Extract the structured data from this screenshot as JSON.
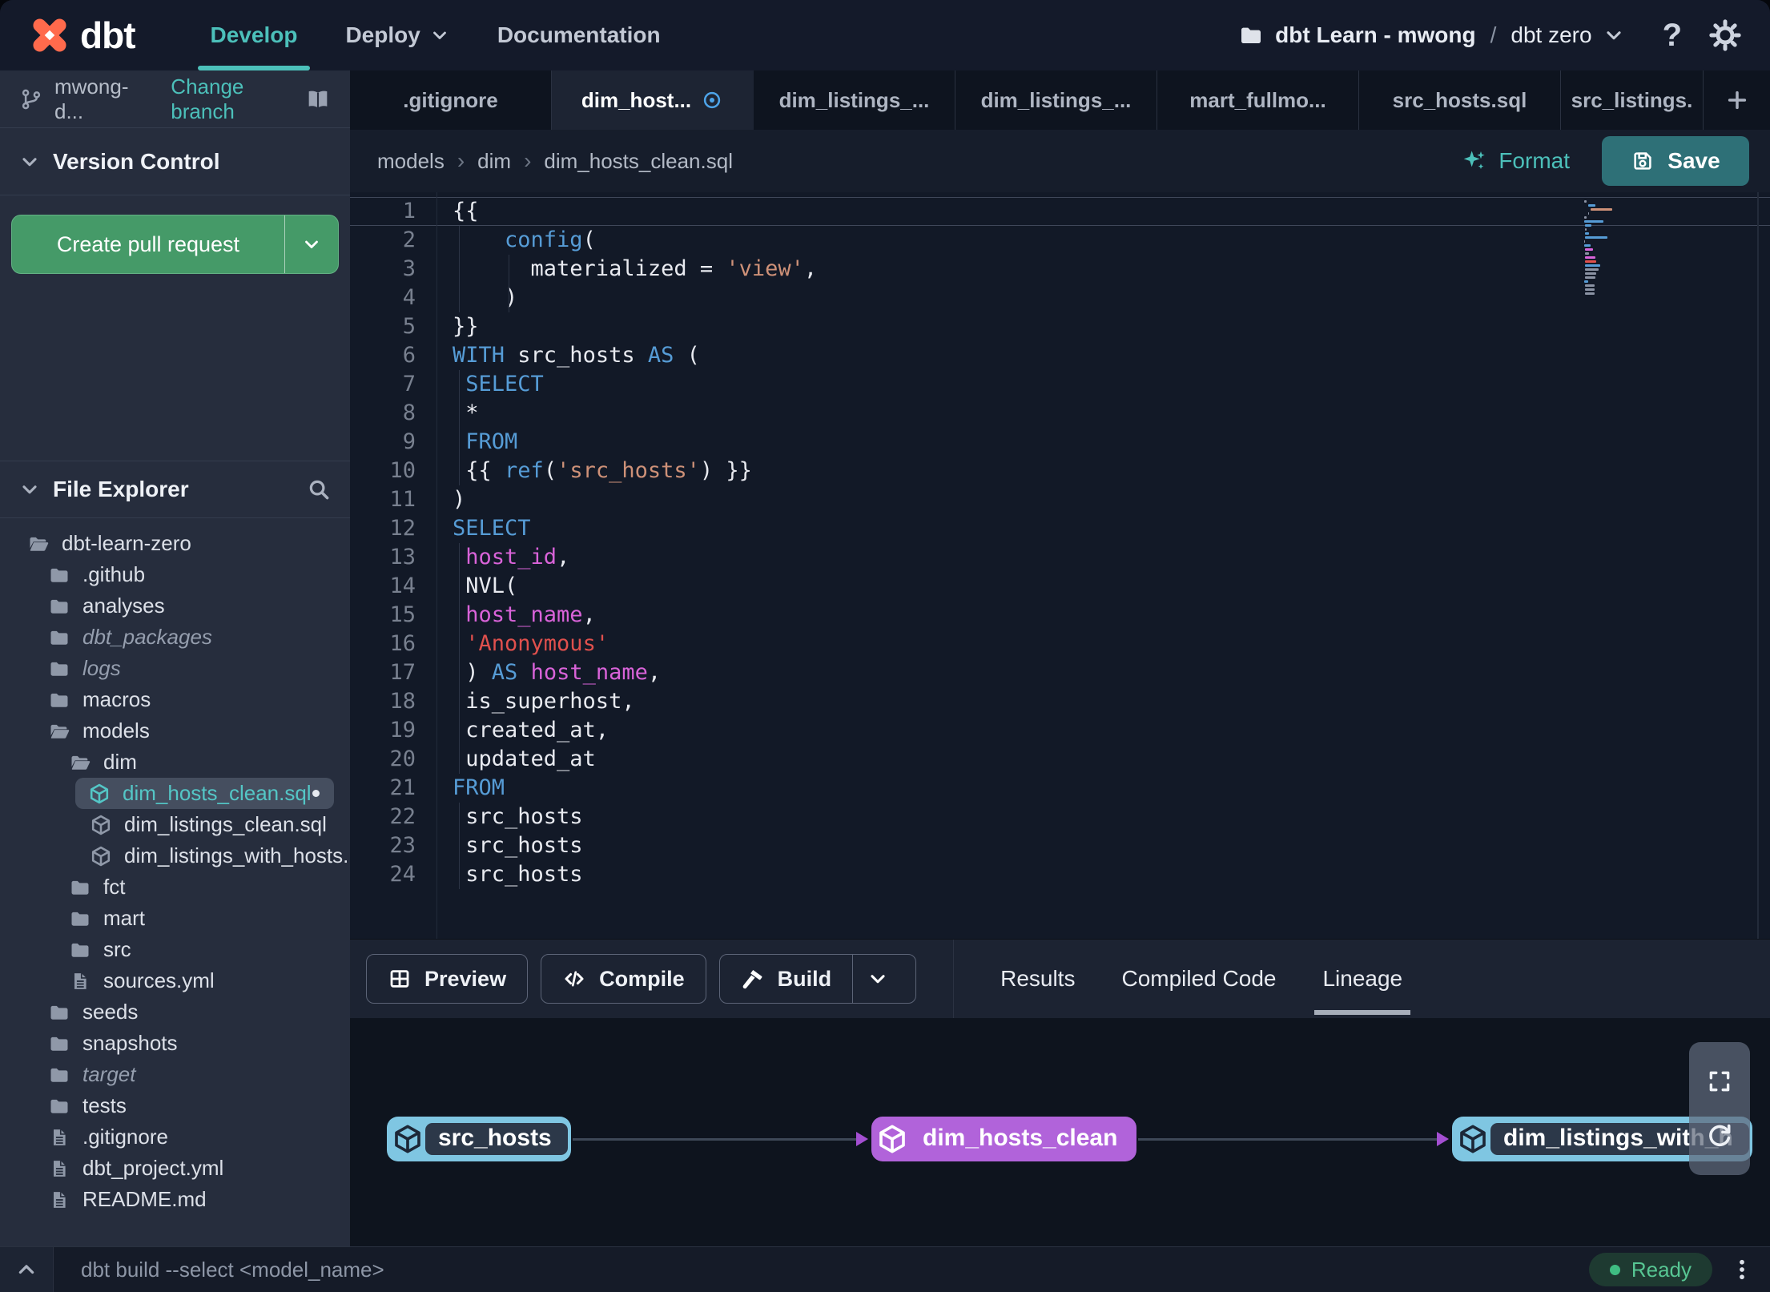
{
  "theme": {
    "accent_teal": "#4cc0ba",
    "accent_green": "#459a68",
    "save_teal": "#2e7077",
    "node_blue": "#7fc6e2",
    "node_purple": "#b163da",
    "modified_blue": "#4da3e8",
    "ready_green": "#57c693",
    "logo_orange": "#ff6a4c"
  },
  "topbar": {
    "logo_text": "dbt",
    "nav": [
      {
        "label": "Develop",
        "active": true,
        "caret": false
      },
      {
        "label": "Deploy",
        "active": false,
        "caret": true
      },
      {
        "label": "Documentation",
        "active": false,
        "caret": false
      }
    ],
    "project": {
      "account": "dbt Learn - mwong",
      "separator": "/",
      "name": "dbt zero"
    },
    "help_label": "?"
  },
  "sidebar": {
    "branch": {
      "name": "mwong-d...",
      "action": "Change branch"
    },
    "version_control": {
      "title": "Version Control",
      "create_pr_label": "Create pull request"
    },
    "file_explorer": {
      "title": "File Explorer"
    },
    "tree": [
      {
        "name": "dbt-learn-zero",
        "type": "folder-open",
        "indent": 0
      },
      {
        "name": ".github",
        "type": "folder",
        "indent": 1
      },
      {
        "name": "analyses",
        "type": "folder",
        "indent": 1
      },
      {
        "name": "dbt_packages",
        "type": "folder",
        "indent": 1,
        "italic": true
      },
      {
        "name": "logs",
        "type": "folder",
        "indent": 1,
        "italic": true
      },
      {
        "name": "macros",
        "type": "folder",
        "indent": 1
      },
      {
        "name": "models",
        "type": "folder-open",
        "indent": 1
      },
      {
        "name": "dim",
        "type": "folder-open",
        "indent": 2
      },
      {
        "name": "dim_hosts_clean.sql",
        "type": "model",
        "indent": 3,
        "selected": true,
        "modified": true
      },
      {
        "name": "dim_listings_clean.sql",
        "type": "model",
        "indent": 3
      },
      {
        "name": "dim_listings_with_hosts...",
        "type": "model",
        "indent": 3
      },
      {
        "name": "fct",
        "type": "folder",
        "indent": 2
      },
      {
        "name": "mart",
        "type": "folder",
        "indent": 2
      },
      {
        "name": "src",
        "type": "folder",
        "indent": 2
      },
      {
        "name": "sources.yml",
        "type": "file",
        "indent": 2
      },
      {
        "name": "seeds",
        "type": "folder",
        "indent": 1
      },
      {
        "name": "snapshots",
        "type": "folder",
        "indent": 1
      },
      {
        "name": "target",
        "type": "folder",
        "indent": 1,
        "italic": true
      },
      {
        "name": "tests",
        "type": "folder",
        "indent": 1
      },
      {
        "name": ".gitignore",
        "type": "file",
        "indent": 1
      },
      {
        "name": "dbt_project.yml",
        "type": "file",
        "indent": 1
      },
      {
        "name": "README.md",
        "type": "file",
        "indent": 1
      }
    ]
  },
  "tabs": {
    "items": [
      {
        "label": ".gitignore",
        "active": false,
        "modified": false
      },
      {
        "label": "dim_host...",
        "active": true,
        "modified": true
      },
      {
        "label": "dim_listings_...",
        "active": false,
        "modified": false
      },
      {
        "label": "dim_listings_...",
        "active": false,
        "modified": false
      },
      {
        "label": "mart_fullmo...",
        "active": false,
        "modified": false
      },
      {
        "label": "src_hosts.sql",
        "active": false,
        "modified": false
      },
      {
        "label": "src_listings.",
        "active": false,
        "modified": false,
        "last": true
      }
    ],
    "new_tab": "+"
  },
  "breadcrumb": {
    "items": [
      "models",
      "dim",
      "dim_hosts_clean.sql"
    ],
    "separator": "›"
  },
  "actions": {
    "format": "Format",
    "save": "Save"
  },
  "editor": {
    "colors": {
      "p": "#e8eaf0",
      "b": "#569cd6",
      "s": "#ce9178",
      "r": "#e0504d",
      "m": "#d963d9"
    },
    "lines": [
      {
        "n": 1,
        "hl": true,
        "seg": [
          [
            "{{",
            "p"
          ]
        ]
      },
      {
        "n": 2,
        "seg": [
          [
            "    ",
            "p"
          ],
          [
            "config",
            "b"
          ],
          [
            "(",
            "p"
          ]
        ]
      },
      {
        "n": 3,
        "seg": [
          [
            "      materialized = ",
            "p"
          ],
          [
            "'view'",
            "s"
          ],
          [
            ",",
            "p"
          ]
        ]
      },
      {
        "n": 4,
        "seg": [
          [
            "    )",
            "p"
          ]
        ]
      },
      {
        "n": 5,
        "seg": [
          [
            "}}",
            "p"
          ]
        ]
      },
      {
        "n": 6,
        "seg": [
          [
            "WITH",
            "b"
          ],
          [
            " src_hosts ",
            "p"
          ],
          [
            "AS",
            "b"
          ],
          [
            " (",
            "p"
          ]
        ]
      },
      {
        "n": 7,
        "seg": [
          [
            " ",
            "p"
          ],
          [
            "SELECT",
            "b"
          ]
        ]
      },
      {
        "n": 8,
        "seg": [
          [
            " *",
            "p"
          ]
        ]
      },
      {
        "n": 9,
        "seg": [
          [
            " ",
            "p"
          ],
          [
            "FROM",
            "b"
          ]
        ]
      },
      {
        "n": 10,
        "seg": [
          [
            " {{ ",
            "p"
          ],
          [
            "ref",
            "b"
          ],
          [
            "(",
            "p"
          ],
          [
            "'src_hosts'",
            "s"
          ],
          [
            ") }}",
            "p"
          ]
        ]
      },
      {
        "n": 11,
        "seg": [
          [
            ")",
            "p"
          ]
        ]
      },
      {
        "n": 12,
        "seg": [
          [
            "SELECT",
            "b"
          ]
        ]
      },
      {
        "n": 13,
        "seg": [
          [
            " ",
            "p"
          ],
          [
            "host_id",
            "m"
          ],
          [
            ",",
            "p"
          ]
        ]
      },
      {
        "n": 14,
        "seg": [
          [
            " NVL(",
            "p"
          ]
        ]
      },
      {
        "n": 15,
        "seg": [
          [
            " ",
            "p"
          ],
          [
            "host_name",
            "m"
          ],
          [
            ",",
            "p"
          ]
        ]
      },
      {
        "n": 16,
        "seg": [
          [
            " ",
            "p"
          ],
          [
            "'Anonymous'",
            "r"
          ]
        ]
      },
      {
        "n": 17,
        "seg": [
          [
            " ) ",
            "p"
          ],
          [
            "AS",
            "b"
          ],
          [
            " ",
            "p"
          ],
          [
            "host_name",
            "m"
          ],
          [
            ",",
            "p"
          ]
        ]
      },
      {
        "n": 18,
        "seg": [
          [
            " is_superhost,",
            "p"
          ]
        ]
      },
      {
        "n": 19,
        "seg": [
          [
            " created_at,",
            "p"
          ]
        ]
      },
      {
        "n": 20,
        "seg": [
          [
            " updated_at",
            "p"
          ]
        ]
      },
      {
        "n": 21,
        "seg": [
          [
            "FROM",
            "b"
          ]
        ]
      },
      {
        "n": 22,
        "seg": [
          [
            " src_hosts",
            "p"
          ]
        ]
      },
      {
        "n": 23,
        "seg": [
          [
            " src_hosts",
            "p"
          ]
        ]
      },
      {
        "n": 24,
        "seg": [
          [
            " src_hosts",
            "p"
          ]
        ]
      }
    ]
  },
  "panel": {
    "buttons": [
      {
        "label": "Preview",
        "icon": "grid",
        "split": false
      },
      {
        "label": "Compile",
        "icon": "code",
        "split": false
      },
      {
        "label": "Build",
        "icon": "hammer",
        "split": true
      }
    ],
    "tabs": [
      {
        "label": "Results",
        "active": false
      },
      {
        "label": "Compiled Code",
        "active": false
      },
      {
        "label": "Lineage",
        "active": true
      }
    ]
  },
  "lineage": {
    "nodes": [
      {
        "label": "src_hosts",
        "variant": "source"
      },
      {
        "label": "dim_hosts_clean",
        "variant": "highlight"
      },
      {
        "label": "dim_listings_with_h",
        "variant": "source"
      }
    ]
  },
  "statusbar": {
    "command_placeholder": "dbt build --select <model_name>",
    "status_label": "Ready"
  }
}
